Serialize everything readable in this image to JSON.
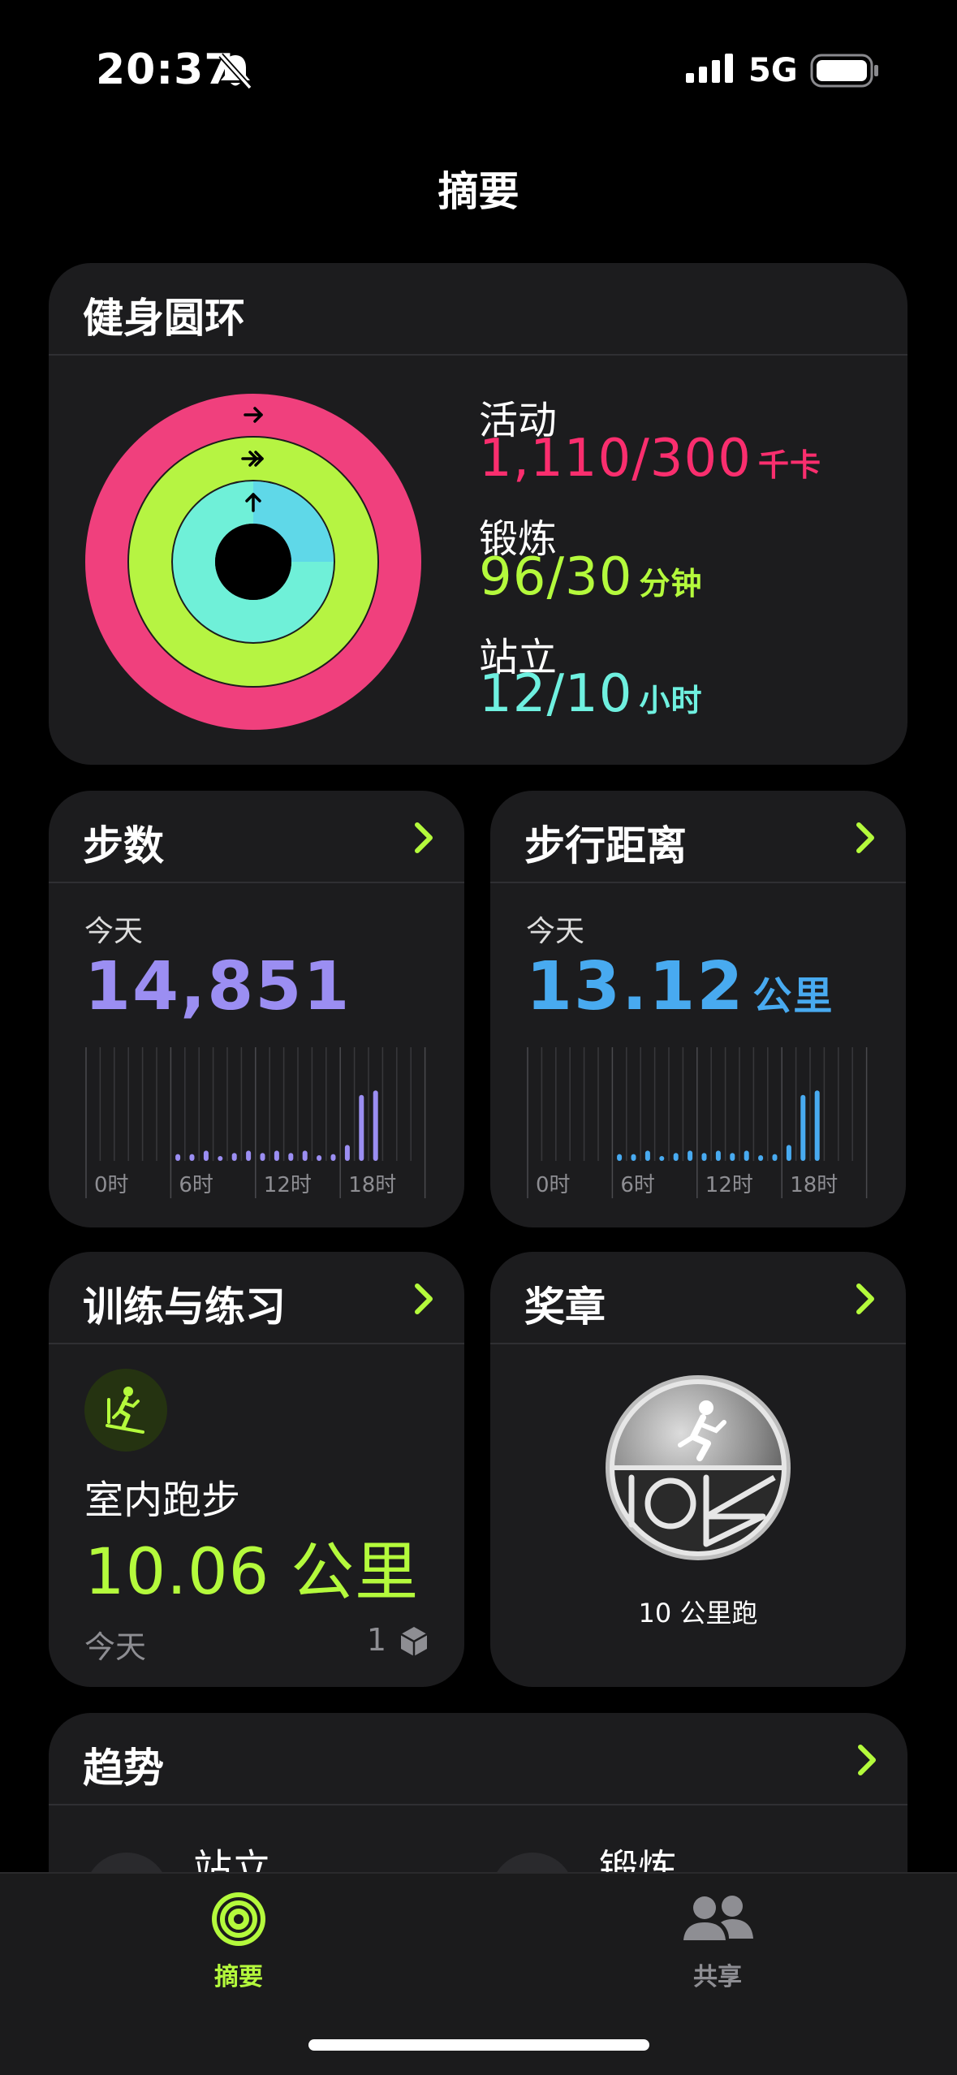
{
  "status_bar": {
    "time": "20:37",
    "network": "5G"
  },
  "page_title": "摘要",
  "activity_rings": {
    "title": "健身圆环",
    "move": {
      "label": "活动",
      "value": "1,110/300",
      "unit": "千卡",
      "color": "#fa2e6e"
    },
    "exercise": {
      "label": "锻炼",
      "value": "96/30",
      "unit": "分钟",
      "color": "#b4fa3c"
    },
    "stand": {
      "label": "站立",
      "value": "12/10",
      "unit": "小时",
      "color": "#6ff0e0"
    }
  },
  "steps": {
    "title": "步数",
    "period": "今天",
    "value": "14,851",
    "color": "#9b8ef2",
    "ticks": [
      "0时",
      "6时",
      "12时",
      "18时"
    ],
    "hourly": [
      0,
      0,
      0,
      0,
      0,
      0,
      0.06,
      0.06,
      0.09,
      0.04,
      0.07,
      0.09,
      0.07,
      0.09,
      0.07,
      0.09,
      0.05,
      0.06,
      0.14,
      0.58,
      0.62,
      0,
      0,
      0
    ]
  },
  "distance": {
    "title": "步行距离",
    "period": "今天",
    "value": "13.12",
    "unit": "公里",
    "color": "#48aaf0",
    "ticks": [
      "0时",
      "6时",
      "12时",
      "18时"
    ],
    "hourly": [
      0,
      0,
      0,
      0,
      0,
      0,
      0.06,
      0.06,
      0.09,
      0.04,
      0.07,
      0.09,
      0.07,
      0.09,
      0.07,
      0.09,
      0.05,
      0.06,
      0.14,
      0.58,
      0.62,
      0,
      0,
      0
    ]
  },
  "workouts": {
    "title": "训练与练习",
    "icon": "treadmill-icon",
    "name": "室内跑步",
    "value": "10.06 公里",
    "date": "今天",
    "count": "1",
    "color": "#b4fa3c"
  },
  "awards": {
    "title": "奖章",
    "badge_label": "10 公里跑"
  },
  "trends": {
    "title": "趋势",
    "items": [
      {
        "label": "站立"
      },
      {
        "label": "锻炼"
      }
    ]
  },
  "tab_bar": {
    "items": [
      {
        "label": "摘要",
        "active": true,
        "color": "#b4fa3c"
      },
      {
        "label": "共享",
        "active": false,
        "color": "#8e8e93"
      }
    ]
  }
}
